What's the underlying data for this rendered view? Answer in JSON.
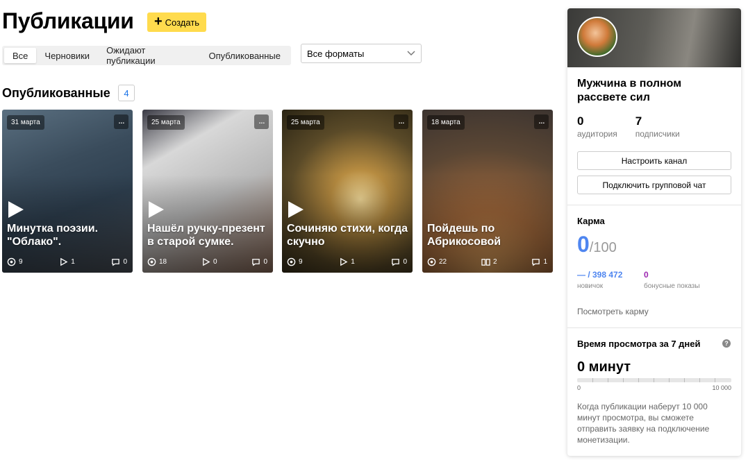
{
  "header": {
    "title": "Публикации",
    "create_label": "Создать"
  },
  "tabs": [
    {
      "label": "Все",
      "active": true
    },
    {
      "label": "Черновики",
      "active": false
    },
    {
      "label": "Ожидают публикации",
      "active": false
    },
    {
      "label": "Опубликованные",
      "active": false
    }
  ],
  "format_select": {
    "value": "Все форматы"
  },
  "section": {
    "title": "Опубликованные",
    "count": "4"
  },
  "cards": [
    {
      "date": "31 марта",
      "title": "Минутка поэзии. \"Облако\".",
      "stat1_icon": "eye-icon",
      "stat1": "9",
      "stat2_icon": "play-icon",
      "stat2": "1",
      "stat3_icon": "comment-icon",
      "stat3": "0",
      "has_play": true
    },
    {
      "date": "25 марта",
      "title": "Нашёл ручку-презент в старой сумке.",
      "stat1_icon": "eye-icon",
      "stat1": "18",
      "stat2_icon": "play-icon",
      "stat2": "0",
      "stat3_icon": "comment-icon",
      "stat3": "0",
      "has_play": true
    },
    {
      "date": "25 марта",
      "title": "Сочиняю стихи, когда скучно",
      "stat1_icon": "eye-icon",
      "stat1": "9",
      "stat2_icon": "play-icon",
      "stat2": "1",
      "stat3_icon": "comment-icon",
      "stat3": "0",
      "has_play": true
    },
    {
      "date": "18 марта",
      "title": "Пойдешь по Абрикосовой",
      "stat1_icon": "eye-icon",
      "stat1": "22",
      "stat2_icon": "book-icon",
      "stat2": "2",
      "stat3_icon": "comment-icon",
      "stat3": "1",
      "has_play": false
    }
  ],
  "channel": {
    "name": "Мужчина в полном рассвете сил",
    "audience_value": "0",
    "audience_label": "аудитория",
    "subscribers_value": "7",
    "subscribers_label": "подписчики",
    "setup_button": "Настроить канал",
    "chat_button": "Подключить групповой чат"
  },
  "karma": {
    "title": "Карма",
    "value": "0",
    "max": "/100",
    "rank_value": "— / 398 472",
    "rank_label": "новичок",
    "bonus_value": "0",
    "bonus_label": "бонусные показы",
    "link": "Посмотреть карму"
  },
  "watch_time": {
    "title": "Время просмотра за 7 дней",
    "value": "0 минут",
    "progress_fraction": 0,
    "scale_min": "0",
    "scale_max": "10 000",
    "note": "Когда публикации наберут 10 000 минут просмотра, вы сможете отправить заявку на подключение монетизации."
  },
  "colors": {
    "accent_yellow": "#ffdb4d",
    "karma_blue": "#4f86f0",
    "bonus_purple": "#9c27b0",
    "link_blue": "#1a73e8"
  }
}
